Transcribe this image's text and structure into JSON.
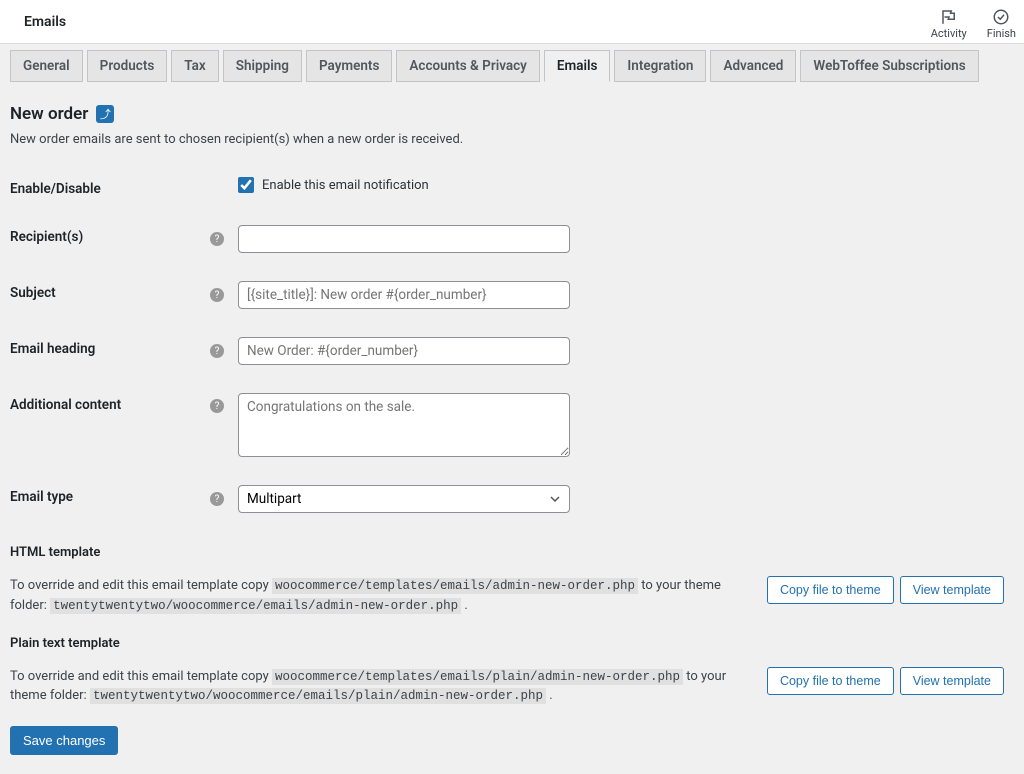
{
  "topbar": {
    "title": "Emails",
    "activity": "Activity",
    "finish": "Finish"
  },
  "tabs": [
    {
      "label": "General"
    },
    {
      "label": "Products"
    },
    {
      "label": "Tax"
    },
    {
      "label": "Shipping"
    },
    {
      "label": "Payments"
    },
    {
      "label": "Accounts & Privacy"
    },
    {
      "label": "Emails",
      "active": true
    },
    {
      "label": "Integration"
    },
    {
      "label": "Advanced"
    },
    {
      "label": "WebToffee Subscriptions"
    }
  ],
  "page": {
    "title": "New order",
    "desc": "New order emails are sent to chosen recipient(s) when a new order is received."
  },
  "form": {
    "enable_label": "Enable/Disable",
    "enable_text": "Enable this email notification",
    "enable_checked": true,
    "recipients_label": "Recipient(s)",
    "recipients_value": "",
    "subject_label": "Subject",
    "subject_placeholder": "[{site_title}]: New order #{order_number}",
    "heading_label": "Email heading",
    "heading_placeholder": "New Order: #{order_number}",
    "additional_label": "Additional content",
    "additional_placeholder": "Congratulations on the sale.",
    "type_label": "Email type",
    "type_value": "Multipart"
  },
  "html_tmpl": {
    "title": "HTML template",
    "lead": "To override and edit this email template copy ",
    "src": "woocommerce/templates/emails/admin-new-order.php",
    "mid": " to your theme folder: ",
    "dst": "twentytwentytwo/woocommerce/emails/admin-new-order.php",
    "tail": " .",
    "copy_btn": "Copy file to theme",
    "view_btn": "View template"
  },
  "plain_tmpl": {
    "title": "Plain text template",
    "lead": "To override and edit this email template copy ",
    "src": "woocommerce/templates/emails/plain/admin-new-order.php",
    "mid": " to your theme folder: ",
    "dst": "twentytwentytwo/woocommerce/emails/plain/admin-new-order.php",
    "tail": " .",
    "copy_btn": "Copy file to theme",
    "view_btn": "View template"
  },
  "save_btn": "Save changes",
  "help_tip": "?"
}
